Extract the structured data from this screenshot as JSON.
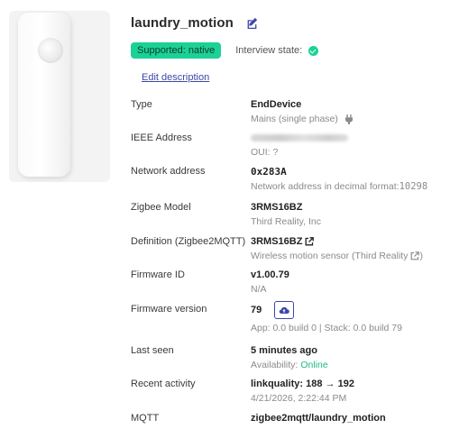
{
  "device": {
    "title": "laundry_motion",
    "supported_badge": "Supported: native",
    "interview_label": "Interview state:",
    "edit_description": "Edit description"
  },
  "rows": {
    "type": {
      "label": "Type",
      "value": "EndDevice",
      "sub": "Mains (single phase)"
    },
    "ieee": {
      "label": "IEEE Address",
      "sub": "OUI: ?"
    },
    "network": {
      "label": "Network address",
      "value": "0x283A",
      "sub_prefix": "Network address in decimal format: ",
      "sub_value": "10298"
    },
    "model": {
      "label": "Zigbee Model",
      "value": "3RMS16BZ",
      "sub": "Third Reality, Inc"
    },
    "definition": {
      "label": "Definition (Zigbee2MQTT)",
      "value": "3RMS16BZ",
      "sub": "Wireless motion sensor (Third Reality"
    },
    "firmware_id": {
      "label": "Firmware ID",
      "value": "v1.00.79",
      "sub": "N/A"
    },
    "firmware_version": {
      "label": "Firmware version",
      "value": "79",
      "sub": "App: 0.0 build 0 | Stack: 0.0 build 79"
    },
    "last_seen": {
      "label": "Last seen",
      "value": "5 minutes ago",
      "sub_prefix": "Availability: ",
      "sub_status": "Online"
    },
    "recent_activity": {
      "label": "Recent activity",
      "value": "linkquality: 188 → 192",
      "sub": "4/21/2026, 2:22:44 PM"
    },
    "mqtt": {
      "label": "MQTT",
      "value": "zigbee2mqtt/laundry_motion"
    }
  },
  "icons": {
    "edit": "pencil-square-icon",
    "check": "check-circle-icon",
    "plug": "plug-icon",
    "external": "external-link-icon",
    "update": "cloud-upload-icon"
  },
  "colors": {
    "accent": "#3b49a8",
    "success": "#1bd196",
    "online": "#1fb888"
  }
}
